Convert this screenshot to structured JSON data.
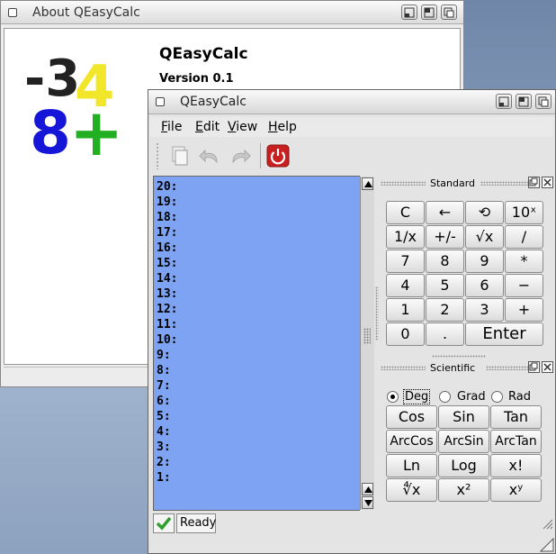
{
  "about": {
    "window_title": "About QEasyCalc",
    "app_name": "QEasyCalc",
    "version": "Version 0.1",
    "logo": {
      "chars": [
        "-3",
        "4",
        "8",
        "+"
      ]
    }
  },
  "main": {
    "window_title": "QEasyCalc",
    "menu": [
      {
        "label": "File",
        "key": "F",
        "rest": "ile"
      },
      {
        "label": "Edit",
        "key": "E",
        "rest": "dit"
      },
      {
        "label": "View",
        "key": "V",
        "rest": "iew"
      },
      {
        "label": "Help",
        "key": "H",
        "rest": "elp"
      }
    ],
    "toolbar": {
      "icons": [
        "copy-icon",
        "undo-icon",
        "redo-icon",
        "power-icon"
      ]
    },
    "stack": {
      "rows": [
        "20:",
        "19:",
        "18:",
        "17:",
        "16:",
        "15:",
        "14:",
        "13:",
        "12:",
        "11:",
        "10:",
        "9:",
        "8:",
        "7:",
        "6:",
        "5:",
        "4:",
        "3:",
        "2:",
        "1:"
      ]
    },
    "standard": {
      "title": "Standard",
      "keys": [
        [
          "C",
          "←",
          "⟲",
          "10ˣ"
        ],
        [
          "1/x",
          "+/-",
          "√x",
          "/"
        ],
        [
          "7",
          "8",
          "9",
          "*"
        ],
        [
          "4",
          "5",
          "6",
          "−"
        ],
        [
          "1",
          "2",
          "3",
          "+"
        ],
        [
          "0",
          ".",
          "Enter"
        ]
      ]
    },
    "scientific": {
      "title": "Scientific",
      "angle_modes": [
        "Deg",
        "Grad",
        "Rad"
      ],
      "selected_mode": "Deg",
      "keys": [
        [
          "Cos",
          "Sin",
          "Tan"
        ],
        [
          "ArcCos",
          "ArcSin",
          "ArcTan"
        ],
        [
          "Ln",
          "Log",
          "x!"
        ],
        [
          "∜x",
          "x²",
          "xʸ"
        ]
      ]
    },
    "status": {
      "text": "Ready"
    }
  },
  "colors": {
    "stack_bg": "#7da3f2",
    "desktop": "#8aa0bf",
    "check_green": "#2e9e2e",
    "power_red": "#c82020"
  }
}
